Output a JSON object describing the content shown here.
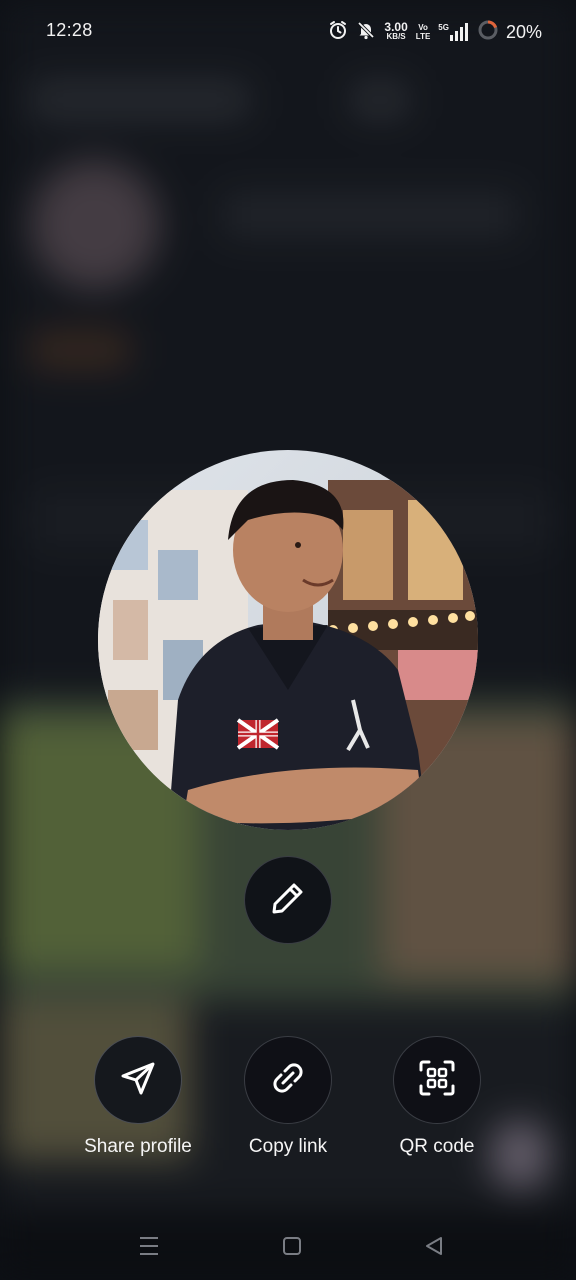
{
  "status_bar": {
    "time": "12:28",
    "network_speed_value": "3.00",
    "network_speed_unit": "KB/S",
    "volte_top": "Vo",
    "volte_bottom": "LTE",
    "network_type": "5G",
    "battery_percent": "20%",
    "icons": [
      "alarm-icon",
      "silent-icon",
      "signal-icon",
      "battery-icon"
    ]
  },
  "profile": {
    "avatar": "profile-photo",
    "edit_icon": "pencil-icon"
  },
  "actions": [
    {
      "label": "Share profile",
      "icon": "send-icon"
    },
    {
      "label": "Copy link",
      "icon": "link-icon"
    },
    {
      "label": "QR code",
      "icon": "qr-scan-icon"
    }
  ],
  "nav_bar": {
    "icons": [
      "menu-icon",
      "home-icon",
      "back-icon"
    ]
  },
  "colors": {
    "background": "#0d1015",
    "button_border": "#3a3d44",
    "text": "#f5f5f5"
  }
}
